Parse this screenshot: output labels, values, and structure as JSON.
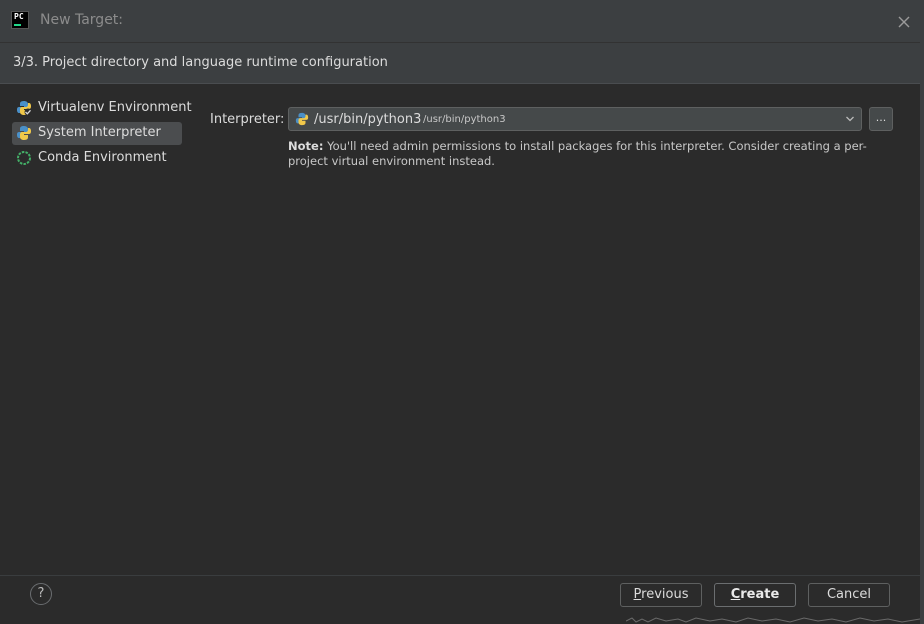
{
  "window": {
    "title": "New Target:",
    "logo_text": "PC"
  },
  "step": {
    "title": "3/3. Project directory and language runtime configuration"
  },
  "sidebar": {
    "items": [
      {
        "label": "Virtualenv Environment",
        "icon": "virtualenv-icon",
        "selected": false
      },
      {
        "label": "System Interpreter",
        "icon": "python-icon",
        "selected": true
      },
      {
        "label": "Conda Environment",
        "icon": "conda-icon",
        "selected": false
      }
    ]
  },
  "interpreter": {
    "label": "Interpreter:",
    "value": "/usr/bin/python3",
    "path": "/usr/bin/python3",
    "browse_label": "..."
  },
  "note": {
    "prefix": "Note:",
    "text": " You'll need admin permissions to install packages for this interpreter. Consider creating a per-project virtual environment instead."
  },
  "footer": {
    "help_label": "?",
    "previous_first": "P",
    "previous_rest": "revious",
    "create_first": "C",
    "create_rest": "reate",
    "cancel_label": "Cancel"
  },
  "colors": {
    "background": "#2b2b2b",
    "panel": "#3c3f41",
    "selection": "#4b4d4f",
    "accent_green": "#21d789"
  }
}
